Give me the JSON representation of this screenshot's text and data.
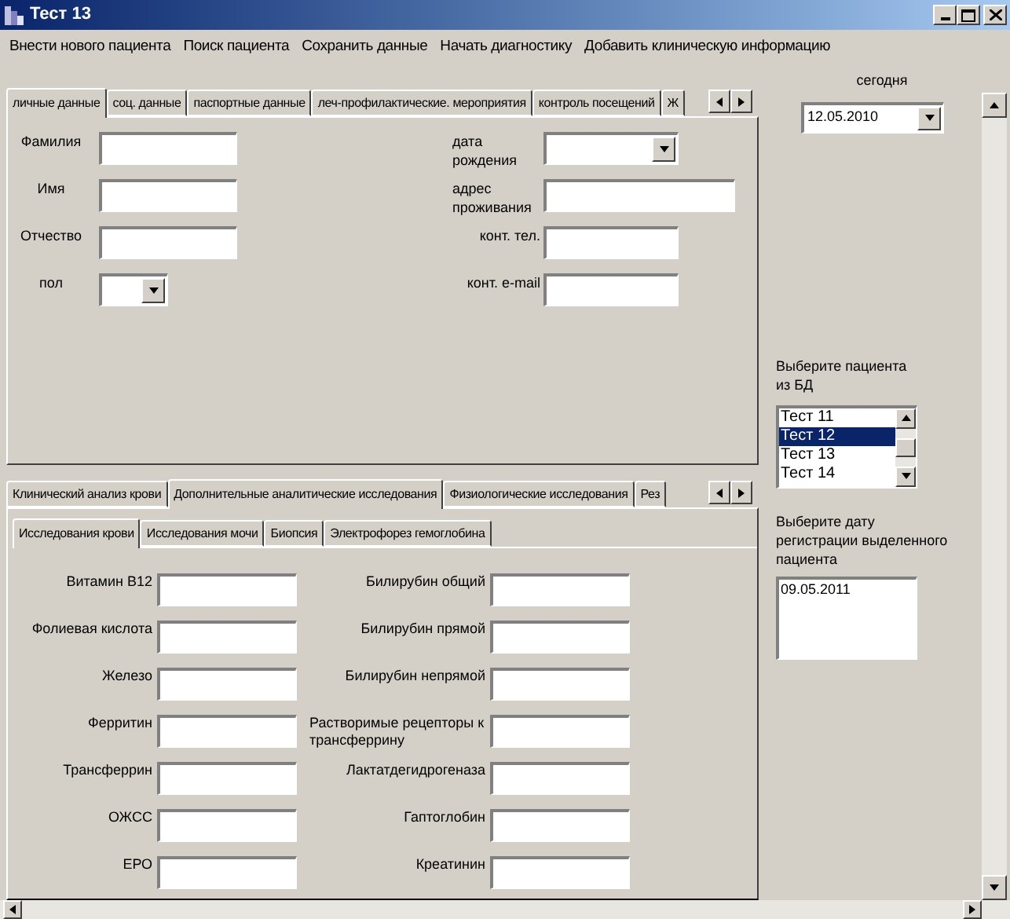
{
  "window": {
    "title": "Тест 13"
  },
  "menu": [
    "Внести нового пациента",
    "Поиск пациента",
    "Сохранить данные",
    "Начать диагностику",
    "Добавить клиническую информацию"
  ],
  "top_tabs": [
    {
      "label": "личные данные",
      "selected": true
    },
    {
      "label": "соц. данные",
      "selected": false
    },
    {
      "label": "паспортные данные",
      "selected": false
    },
    {
      "label": "леч-профилактические. мероприятия",
      "selected": false
    },
    {
      "label": "контроль посещений",
      "selected": false
    },
    {
      "label": "Ж",
      "selected": false
    }
  ],
  "personal_left": [
    {
      "label": "Фамилия",
      "kind": "text"
    },
    {
      "label": "Имя",
      "kind": "text"
    },
    {
      "label": "Отчество",
      "kind": "text"
    },
    {
      "label": "пол",
      "kind": "dropdown"
    }
  ],
  "personal_right": [
    {
      "label": "дата рождения",
      "kind": "dropdown"
    },
    {
      "label": "адрес проживания",
      "kind": "wide"
    },
    {
      "label": "конт. тел.",
      "kind": "text"
    },
    {
      "label": "конт. e-mail",
      "kind": "text"
    }
  ],
  "section_tabs": [
    {
      "label": "Клинический анализ крови",
      "selected": false
    },
    {
      "label": "Дополнительные аналитические исследования",
      "selected": true
    },
    {
      "label": "Физиологические исследования",
      "selected": false
    },
    {
      "label": "Рез",
      "selected": false
    }
  ],
  "sub_tabs": [
    {
      "label": "Исследования крови",
      "selected": true
    },
    {
      "label": "Исследования мочи",
      "selected": false
    },
    {
      "label": "Биопсия",
      "selected": false
    },
    {
      "label": "Электрофорез гемоглобина",
      "selected": false
    }
  ],
  "blood_left": [
    "Витамин В12",
    "Фолиевая кислота",
    "Железо",
    "Ферритин",
    "Трансферрин",
    "ОЖСС",
    "ЕРО"
  ],
  "blood_right": [
    "Билирубин общий",
    "Билирубин прямой",
    "Билирубин непрямой",
    "Растворимые рецепторы к трансферрину",
    "Лактатдегидрогеназа",
    "Гаптоглобин",
    "Креатинин"
  ],
  "today": {
    "label": "сегодня",
    "value": "12.05.2010"
  },
  "patients": {
    "label": "Выберите пациента из БД",
    "items": [
      {
        "label": "Тест 11",
        "selected": false
      },
      {
        "label": "Тест 12",
        "selected": true
      },
      {
        "label": "Тест 13",
        "selected": false
      },
      {
        "label": "Тест 14",
        "selected": false
      }
    ]
  },
  "registration": {
    "label": "Выберите дату регистрации выделенного пациента",
    "items": [
      "09.05.2011"
    ]
  }
}
